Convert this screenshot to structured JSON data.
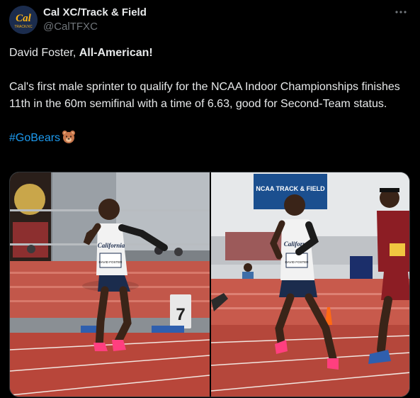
{
  "account": {
    "display_name": "Cal XC/Track & Field",
    "handle": "@CalTFXC",
    "avatar_text_top": "Cal",
    "avatar_text_bottom": "TRACK/XC"
  },
  "tweet": {
    "line1_prefix": "David Foster, ",
    "line1_bold": "All-American!",
    "body": "Cal's first male sprinter to qualify for the NCAA Indoor Championships finishes 11th in the 60m semifinal with a time of 6.63, good for Second-Team status.",
    "hashtag": "#GoBears",
    "emoji": "bear-face-emoji"
  },
  "media": {
    "photos": [
      {
        "jersey_text": "California",
        "bib_text": "DAVID FOSTER",
        "hurdle_number": "7",
        "icon": "photo-sprinter-start"
      },
      {
        "jersey_text": "California",
        "bib_text": "DAVID FOSTER",
        "banner_text": "NCAA TRACK & FIELD",
        "rival_bib": "",
        "icon": "photo-sprinter-race"
      }
    ]
  },
  "colors": {
    "background": "#000000",
    "text": "#e7e9ea",
    "secondary": "#71767b",
    "link": "#1d9bf0",
    "track": "#b54a3c",
    "cal_blue": "#1b2c4d",
    "cal_gold": "#fdb515"
  }
}
